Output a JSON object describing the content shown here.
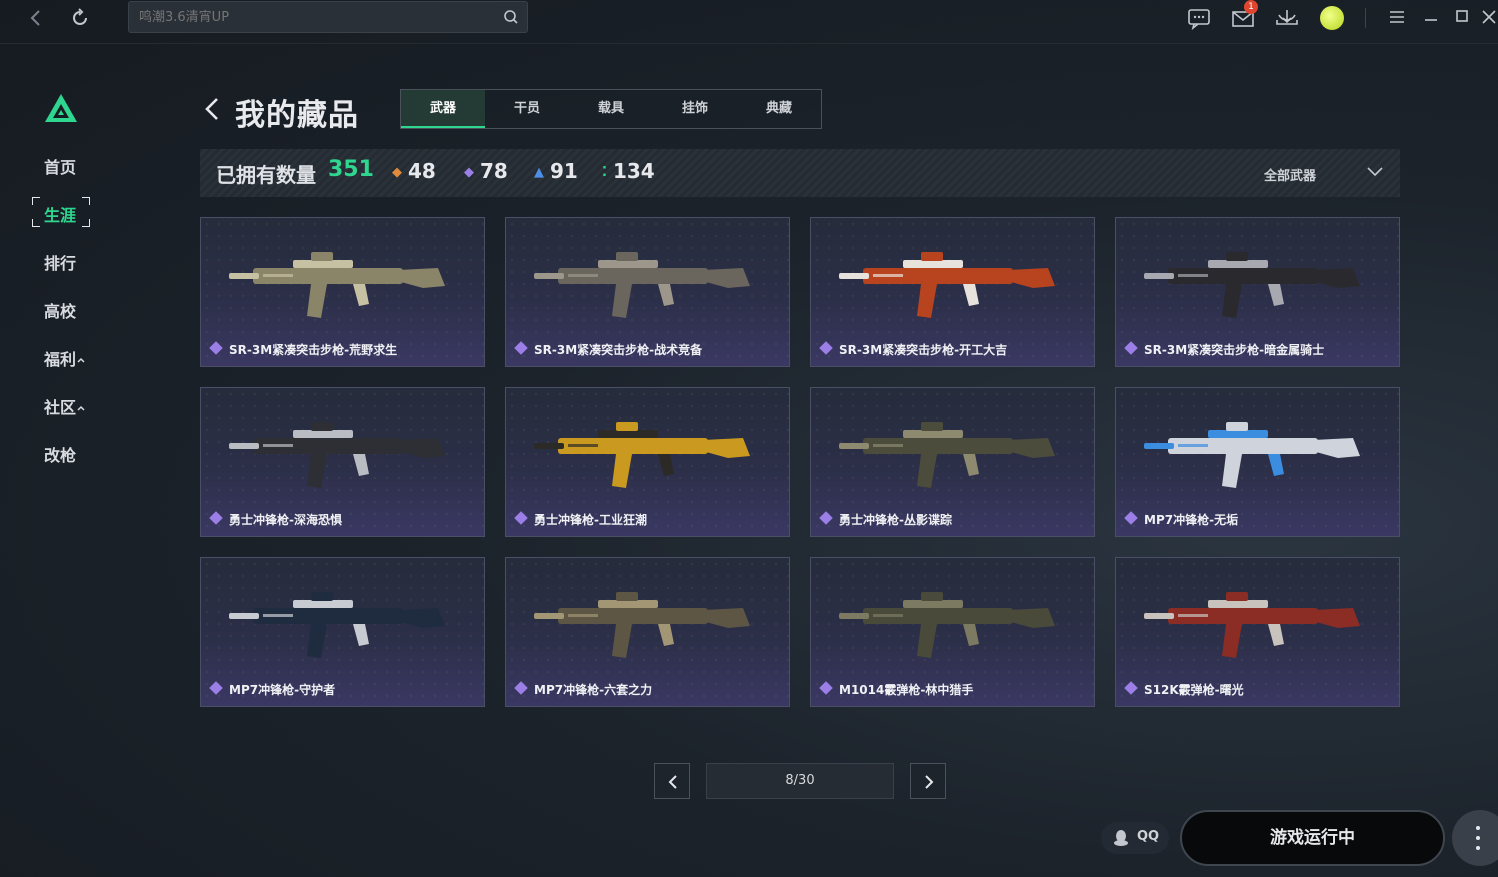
{
  "topbar": {
    "search_placeholder": "鸣潮3.6清宵UP",
    "mail_badge": "1"
  },
  "sidebar": {
    "items": [
      {
        "label": "首页"
      },
      {
        "label": "生涯",
        "active": true
      },
      {
        "label": "排行"
      },
      {
        "label": "高校"
      },
      {
        "label": "福利",
        "expandable": true
      },
      {
        "label": "社区",
        "expandable": true
      },
      {
        "label": "改枪"
      }
    ]
  },
  "header": {
    "title": "我的藏品",
    "tabs": [
      "武器",
      "干员",
      "载具",
      "挂饰",
      "典藏"
    ],
    "active_tab": "武器"
  },
  "stats": {
    "owned_label": "已拥有数量",
    "owned_count": "351",
    "rarity_counts": [
      {
        "value": "48",
        "color": "#e08a3c"
      },
      {
        "value": "78",
        "color": "#9b7fe6"
      },
      {
        "value": "91",
        "color": "#4f8ee6"
      },
      {
        "value": "134",
        "color": "#2fd68f"
      }
    ],
    "filter": "全部武器"
  },
  "items": [
    {
      "name": "SR-3M紧凑突击步枪-荒野求生",
      "colors": [
        "#8a8468",
        "#c7c1a3"
      ]
    },
    {
      "name": "SR-3M紧凑突击步枪-战术竞备",
      "colors": [
        "#6a665e",
        "#9c978a"
      ]
    },
    {
      "name": "SR-3M紧凑突击步枪-开工大吉",
      "colors": [
        "#b8431f",
        "#e8e2dc"
      ]
    },
    {
      "name": "SR-3M紧凑突击步枪-暗金属骑士",
      "colors": [
        "#2a2a2e",
        "#a8a8b0"
      ]
    },
    {
      "name": "勇士冲锋枪-深海恐惧",
      "colors": [
        "#2d2f35",
        "#b9bcc2"
      ]
    },
    {
      "name": "勇士冲锋枪-工业狂潮",
      "colors": [
        "#c99a1f",
        "#2b2a26"
      ]
    },
    {
      "name": "勇士冲锋枪-丛影谍踪",
      "colors": [
        "#4b4c3c",
        "#8d8a70"
      ]
    },
    {
      "name": "MP7冲锋枪-无垢",
      "colors": [
        "#cfd4dc",
        "#3b8de0"
      ]
    },
    {
      "name": "MP7冲锋枪-守护者",
      "colors": [
        "#1f2c3f",
        "#c8ccd2"
      ]
    },
    {
      "name": "MP7冲锋枪-六套之力",
      "colors": [
        "#5e5645",
        "#a39675"
      ]
    },
    {
      "name": "M1014霰弹枪-林中猎手",
      "colors": [
        "#4a4a3a",
        "#7d7a62"
      ]
    },
    {
      "name": "S12K霰弹枪-曙光",
      "colors": [
        "#8c2d25",
        "#c8c3bd"
      ]
    }
  ],
  "pagination": {
    "display": "8/30"
  },
  "footer": {
    "qq_label": "QQ",
    "launch_label": "游戏运行中"
  }
}
